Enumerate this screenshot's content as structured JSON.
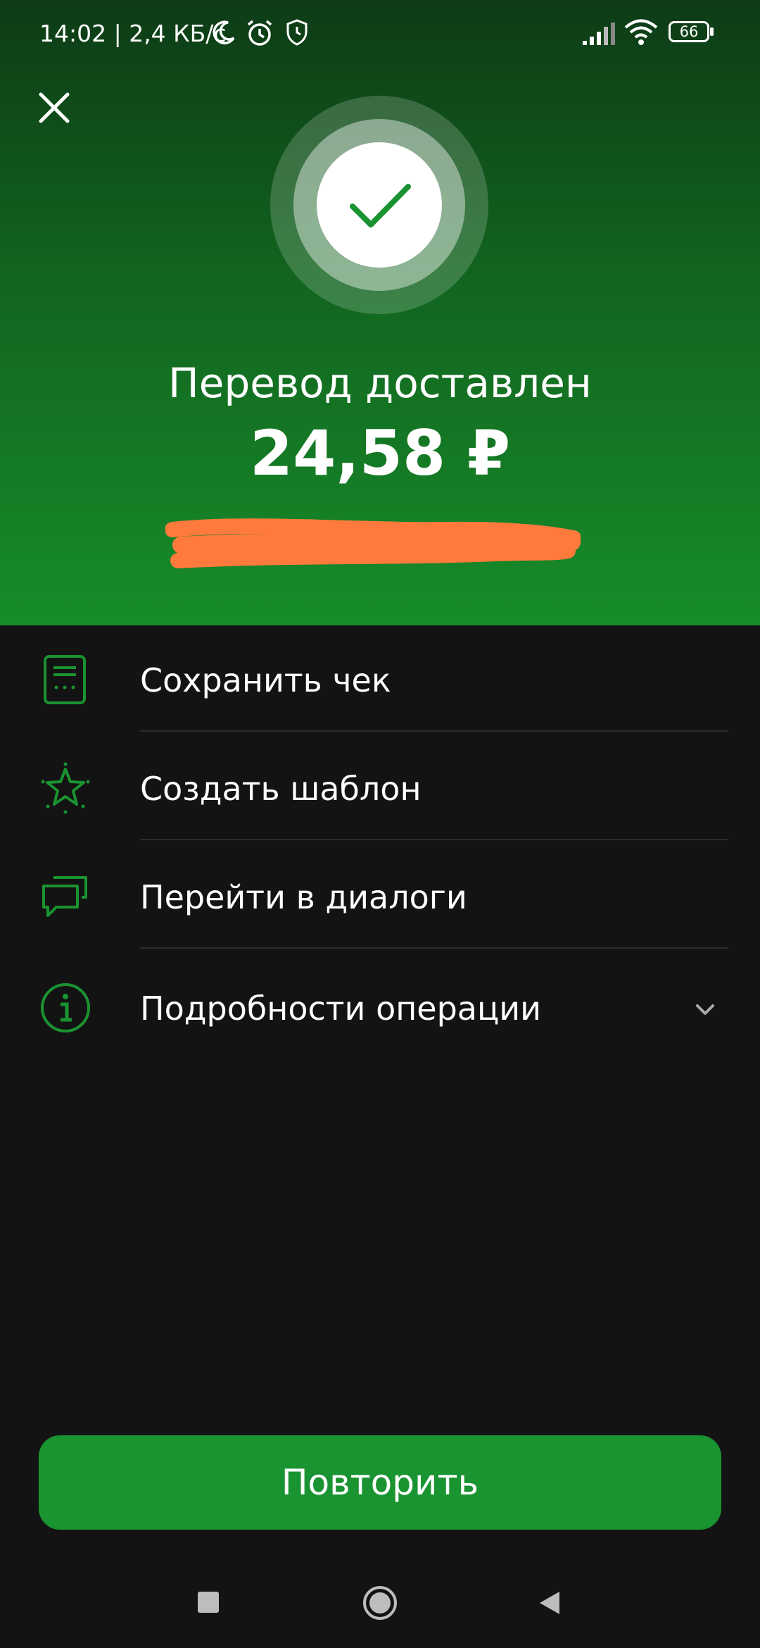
{
  "status_bar": {
    "time_speed": "14:02 | 2,4 КБ/с",
    "battery": "66",
    "icons": [
      "moon-icon",
      "alarm-icon",
      "shield-icon",
      "signal-icon",
      "wifi-icon",
      "battery-icon"
    ]
  },
  "header": {
    "title": "Перевод доставлен",
    "amount": "24,58 ₽",
    "recipient_redacted": true
  },
  "actions": [
    {
      "label": "Сохранить чек",
      "icon": "receipt-icon"
    },
    {
      "label": "Создать шаблон",
      "icon": "star-icon"
    },
    {
      "label": "Перейти в диалоги",
      "icon": "chat-icon"
    },
    {
      "label": "Подробности операции",
      "icon": "info-icon"
    }
  ],
  "repeat_button": "Повторить",
  "colors": {
    "accent": "#1a9331",
    "background": "#131313",
    "hero_top": "#0d3b16",
    "hero_bottom": "#178c2a",
    "redaction": "#ff7a3c"
  }
}
